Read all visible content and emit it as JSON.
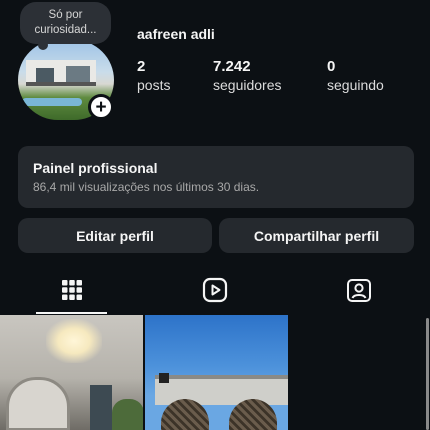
{
  "profile": {
    "note": "Só por curiosidad...",
    "username": "aafreen adli",
    "stats": [
      {
        "value": "2",
        "label": "posts"
      },
      {
        "value": "7.242",
        "label": "seguidores"
      },
      {
        "value": "0",
        "label": "seguindo"
      }
    ],
    "add_icon": "plus-icon"
  },
  "professional_panel": {
    "title": "Painel profissional",
    "subtitle": "86,4 mil visualizações nos últimos 30 dias."
  },
  "actions": {
    "edit_label": "Editar perfil",
    "share_label": "Compartilhar perfil"
  },
  "tabs": [
    {
      "icon": "grid-icon",
      "selected": true
    },
    {
      "icon": "reels-icon",
      "selected": false
    },
    {
      "icon": "tagged-person-icon",
      "selected": false
    }
  ],
  "colors": {
    "background": "#0c1014",
    "card": "#25292e",
    "text": "#f5f5f5",
    "muted": "#a8a8a8"
  }
}
